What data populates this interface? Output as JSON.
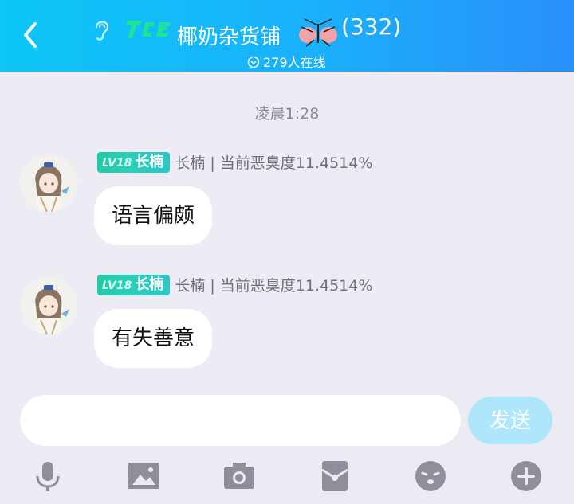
{
  "header": {
    "back_icon": "back-arrow-icon",
    "group_name": "椰奶杂货铺",
    "member_count": "(332)",
    "online_count": "279人在线",
    "bg_start": "#0cc7f7",
    "bg_end": "#2a8ffb"
  },
  "chat": {
    "time_label": "凌晨1:28",
    "messages": [
      {
        "badge_level": "LV18",
        "badge_title": "长楠",
        "sender": "长楠 | 当前恶臭度11.4514%",
        "text": "语言偏颇"
      },
      {
        "badge_level": "LV18",
        "badge_title": "长楠",
        "sender": "长楠 | 当前恶臭度11.4514%",
        "text": "有失善意"
      }
    ]
  },
  "input": {
    "value": "",
    "send_label": "发送",
    "send_color": "#aee6fb"
  },
  "toolbar": {
    "icons": [
      "microphone-icon",
      "image-icon",
      "camera-icon",
      "red-packet-icon",
      "emoji-icon",
      "plus-icon"
    ]
  }
}
